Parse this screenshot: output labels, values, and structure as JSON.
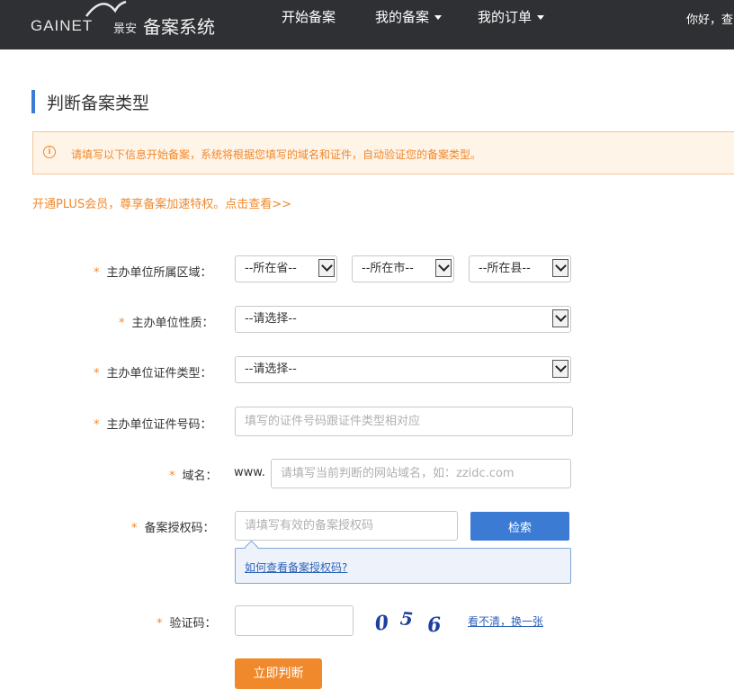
{
  "header": {
    "brand_mark": "GAINET",
    "brand_cn": "景安",
    "system_title": "备案系统",
    "nav": [
      {
        "label": "开始备案",
        "has_dropdown": false
      },
      {
        "label": "我的备案",
        "has_dropdown": true
      },
      {
        "label": "我的订单",
        "has_dropdown": true
      }
    ],
    "greeting": "你好，查"
  },
  "page": {
    "title": "判断备案类型",
    "notice": "请填写以下信息开始备案，系统将根据您填写的域名和证件，自动验证您的备案类型。",
    "plus_link": "开通PLUS会员，尊享备案加速特权。点击查看>>"
  },
  "form": {
    "required_mark": "*",
    "region": {
      "label": "主办单位所属区域：",
      "province": "--所在省--",
      "city": "--所在市--",
      "county": "--所在县--"
    },
    "nature": {
      "label": "主办单位性质：",
      "value": "--请选择--"
    },
    "cert_type": {
      "label": "主办单位证件类型：",
      "value": "--请选择--"
    },
    "cert_no": {
      "label": "主办单位证件号码：",
      "placeholder": "填写的证件号码跟证件类型相对应"
    },
    "domain": {
      "label": "域名：",
      "prefix": "www.",
      "placeholder": "请填写当前判断的网站域名，如：zzidc.com"
    },
    "auth_code": {
      "label": "备案授权码：",
      "placeholder": "请填写有效的备案授权码",
      "search_label": "检索",
      "help_link": "如何查看备案授权码?"
    },
    "captcha": {
      "label": "验证码：",
      "value": "",
      "image_text": "056",
      "refresh_label": "看不清，换一张"
    },
    "submit_label": "立即判断"
  },
  "colors": {
    "header_bg": "#2f3033",
    "accent_blue": "#3b7bd4",
    "accent_orange": "#f0892c",
    "notice_bg": "#fff4e8"
  }
}
